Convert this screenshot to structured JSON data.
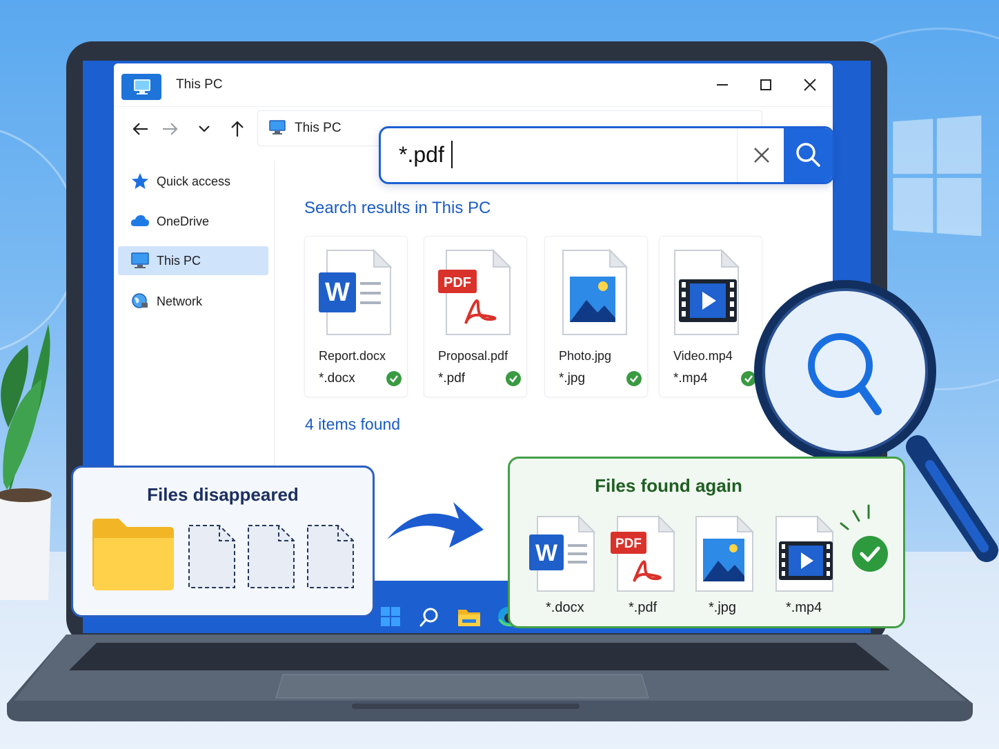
{
  "window": {
    "title": "This PC",
    "address": "This PC"
  },
  "search": {
    "value": "*.pdf"
  },
  "sidebar": {
    "items": [
      {
        "label": "Quick access",
        "icon": "star-icon",
        "active": false
      },
      {
        "label": "OneDrive",
        "icon": "cloud-icon",
        "active": false
      },
      {
        "label": "This PC",
        "icon": "computer-icon",
        "active": true
      },
      {
        "label": "Network",
        "icon": "network-globe-icon",
        "active": false
      }
    ]
  },
  "results": {
    "title": "Search results in This PC",
    "files": [
      {
        "name": "Report.docx",
        "ext": "*.docx",
        "icon": "word-file-icon"
      },
      {
        "name": "Proposal.pdf",
        "ext": "*.pdf",
        "icon": "pdf-file-icon"
      },
      {
        "name": "Photo.jpg",
        "ext": "*.jpg",
        "icon": "image-file-icon"
      },
      {
        "name": "Video.mp4",
        "ext": "*.mp4",
        "icon": "video-file-icon"
      }
    ],
    "count": "4 items found"
  },
  "panel_left": {
    "title": "Files disappeared"
  },
  "panel_right": {
    "title": "Files found again",
    "files": [
      {
        "ext": "*.docx"
      },
      {
        "ext": "*.pdf"
      },
      {
        "ext": "*.jpg"
      },
      {
        "ext": "*.mp4"
      }
    ]
  },
  "badges": {
    "word": "W",
    "pdf": "PDF"
  },
  "colors": {
    "accent": "#1e66db",
    "link_blue": "#1a5bc4",
    "success_green": "#43a047",
    "sidebar_active": "#cfe3fb"
  }
}
